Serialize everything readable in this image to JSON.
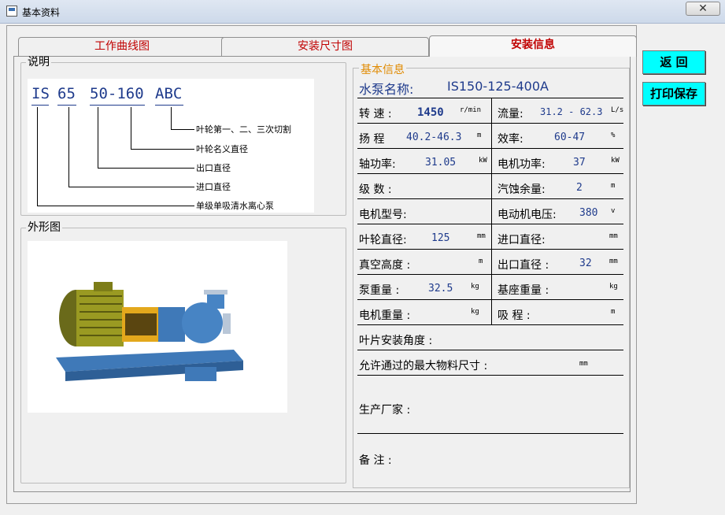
{
  "window": {
    "title": "基本资料",
    "close_symbol": "✕"
  },
  "tabs": [
    {
      "label": "工作曲线图",
      "active": false
    },
    {
      "label": "安装尺寸图",
      "active": false
    },
    {
      "label": "安装信息",
      "active": true
    }
  ],
  "explanation": {
    "legend": "说明",
    "code_parts": [
      "IS",
      "65",
      "50-160",
      "ABC"
    ],
    "labels": [
      "叶轮第一、二、三次切割",
      "叶轮名义直径",
      "出口直径",
      "进口直径",
      "单级单吸清水离心泵"
    ]
  },
  "outline": {
    "legend": "外形图"
  },
  "info": {
    "legend": "基本信息",
    "pump_name_label": "水泵名称:",
    "pump_name": "IS150-125-400A",
    "rows": [
      {
        "left_label": "转 速 :",
        "left_value": "1450",
        "left_unit": "r/min",
        "right_label": "流量:",
        "right_value": "31.2 - 62.3",
        "right_unit": "L/s"
      },
      {
        "left_label": "扬 程",
        "left_value": "40.2-46.3",
        "left_unit": "m",
        "right_label": "效率:",
        "right_value": "60-47",
        "right_unit": "%"
      },
      {
        "left_label": "轴功率:",
        "left_value": "31.05",
        "left_unit": "kW",
        "right_label": "电机功率:",
        "right_value": "37",
        "right_unit": "kW"
      },
      {
        "left_label": "级 数 :",
        "left_value": "",
        "left_unit": "",
        "right_label": "汽蚀余量:",
        "right_value": "2",
        "right_unit": "m"
      },
      {
        "left_label": "电机型号:",
        "left_value": "",
        "left_unit": "",
        "right_label": "电动机电压:",
        "right_value": "380",
        "right_unit": "v"
      },
      {
        "left_label": "叶轮直径:",
        "left_value": "125",
        "left_unit": "mm",
        "right_label": "进口直径:",
        "right_value": "",
        "right_unit": "mm"
      },
      {
        "left_label": "真空高度 :",
        "left_value": "",
        "left_unit": "m",
        "right_label": "出口直径 :",
        "right_value": "32",
        "right_unit": "mm"
      },
      {
        "left_label": "泵重量 :",
        "left_value": "32.5",
        "left_unit": "kg",
        "right_label": "基座重量 :",
        "right_value": "",
        "right_unit": "kg"
      },
      {
        "left_label": "电机重量 :",
        "left_value": "",
        "left_unit": "kg",
        "right_label": "吸 程 :",
        "right_value": "",
        "right_unit": "m"
      }
    ],
    "blade_angle_label": "叶片安装角度 :",
    "max_particle_label": "允许通过的最大物料尺寸 :",
    "max_particle_unit": "mm",
    "manufacturer_label": "生产厂家 :",
    "remarks_label": "备 注 :"
  },
  "buttons": {
    "back": "返 回",
    "print_save": "打印保存"
  }
}
